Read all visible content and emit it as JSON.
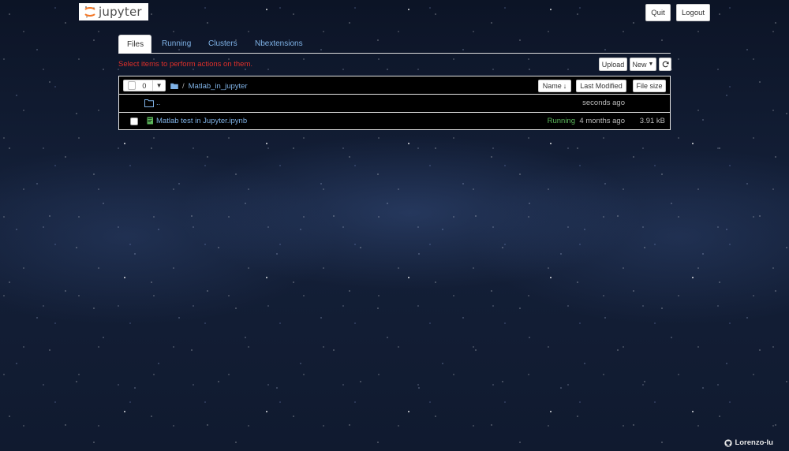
{
  "header": {
    "logo_text": "jupyter",
    "quit_label": "Quit",
    "logout_label": "Logout"
  },
  "tabs": [
    {
      "label": "Files",
      "active": true
    },
    {
      "label": "Running",
      "active": false
    },
    {
      "label": "Clusters",
      "active": false
    },
    {
      "label": "Nbextensions",
      "active": false
    }
  ],
  "toolbar": {
    "hint": "Select items to perform actions on them.",
    "upload_label": "Upload",
    "new_label": "New",
    "refresh_icon": "refresh-icon"
  },
  "list": {
    "selected_count": "0",
    "breadcrumb": {
      "separator": "/",
      "folder": "Matlab_in_jupyter"
    },
    "sort_buttons": {
      "name": "Name",
      "last_modified": "Last Modified",
      "file_size": "File size"
    },
    "rows": [
      {
        "name": "..",
        "type": "folder",
        "modified": "seconds ago",
        "size": "",
        "status": ""
      },
      {
        "name": "Matlab test in Jupyter.ipynb",
        "type": "notebook",
        "modified": "4 months ago",
        "size": "3.91 kB",
        "status": "Running"
      }
    ]
  },
  "footer": {
    "author": "Lorenzo-lu",
    "icon": "github-icon"
  },
  "colors": {
    "link": "#7fb2e6",
    "running": "#5cb85c",
    "hint": "#e0302a",
    "logo_orange": "#f37726"
  }
}
